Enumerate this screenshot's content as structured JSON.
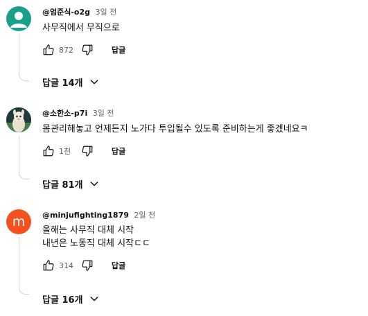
{
  "comments": [
    {
      "author": "@엄준식-o2g",
      "time": "3일 전",
      "lines": [
        "사무직에서 무직으로"
      ],
      "likes": "872",
      "reply_label": "답글",
      "replies_label": "답글 14개",
      "avatar": {
        "icon": "default-person-icon",
        "bg": "#1aa08a"
      }
    },
    {
      "author": "@소한소-p7i",
      "time": "3일 전",
      "lines": [
        "몸관리해놓고 언제든지 노가다 투입될수 있도록 준비하는게 좋겠네요ㅋ"
      ],
      "likes": "1천",
      "reply_label": "답글",
      "replies_label": "답글 81개",
      "avatar": {
        "icon": "alpaca-icon",
        "bg": "#1f3a3a"
      }
    },
    {
      "author": "@minjufighting1879",
      "time": "2일 전",
      "lines": [
        "올해는 사무직 대체 시작",
        "내년은 노동직 대체 시작ㄷㄷ"
      ],
      "likes": "314",
      "reply_label": "답글",
      "replies_label": "답글 16개",
      "avatar": {
        "letter": "m",
        "bg": "#f4511e"
      }
    }
  ]
}
